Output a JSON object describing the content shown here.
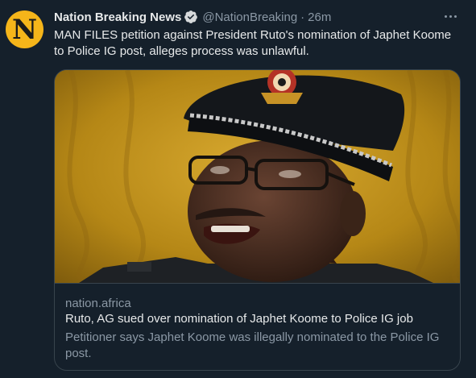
{
  "tweet": {
    "author": {
      "avatar_letter": "N",
      "display_name": "Nation Breaking News",
      "verified": true,
      "handle": "@NationBreaking",
      "separator": "·",
      "time": "26m"
    },
    "text": "MAN FILES petition against President Ruto's nomination of Japhet Koome to Police IG post, alleges process was unlawful.",
    "card": {
      "domain": "nation.africa",
      "title": "Ruto, AG sued over nomination of Japhet Koome to Police IG job",
      "description": "Petitioner says Japhet Koome was illegally nominated to the Police IG post."
    }
  },
  "icons": {
    "verified": "verified-badge-icon",
    "more": "more-options-icon"
  },
  "colors": {
    "background": "#15202b",
    "primary_text": "#e7e9ea",
    "secondary_text": "#8b98a5",
    "border": "#38444d",
    "avatar_bg": "#f5b51a"
  }
}
